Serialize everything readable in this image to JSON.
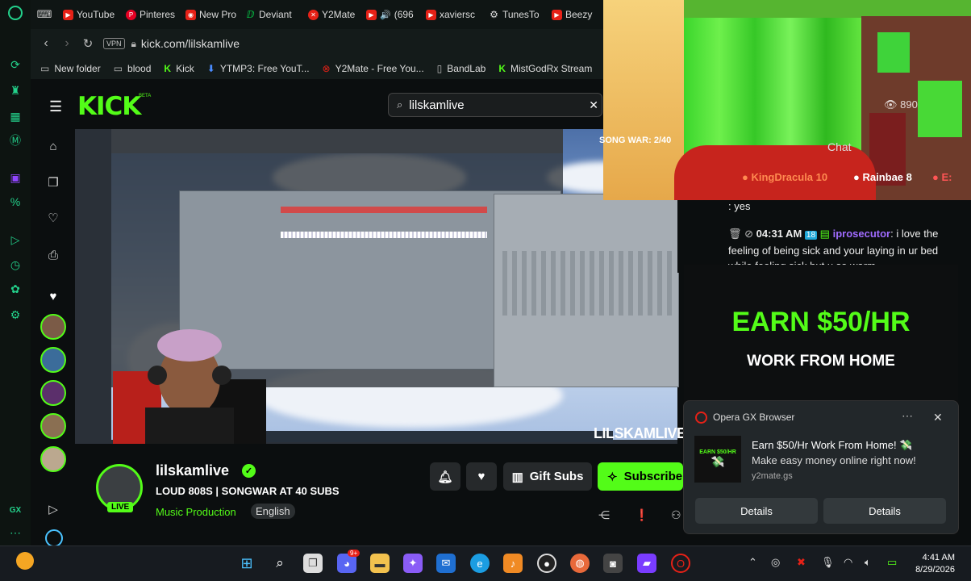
{
  "browser": {
    "tabs": [
      {
        "label": "YouTube",
        "color": "#e62117"
      },
      {
        "label": "Pinteres",
        "color": "#e60023"
      },
      {
        "label": "New Pro",
        "color": "#e62117"
      },
      {
        "label": "Deviant",
        "color": "#05cc47"
      },
      {
        "label": "Y2Mate",
        "color": "#e62117"
      },
      {
        "label": "(696",
        "color": "#e62117"
      },
      {
        "label": "xaviersc",
        "color": "#e62117"
      },
      {
        "label": "TunesTo",
        "color": "#555"
      },
      {
        "label": "Beezy",
        "color": "#e62117"
      }
    ],
    "vpn_label": "VPN",
    "url": "kick.com/lilskamlive",
    "bookmarks": [
      {
        "label": "New folder",
        "icon": "folder-icon"
      },
      {
        "label": "blood",
        "icon": "folder-icon"
      },
      {
        "label": "Kick",
        "icon": "kick-icon"
      },
      {
        "label": "YTMP3: Free YouT...",
        "icon": "download-icon"
      },
      {
        "label": "Y2Mate - Free You...",
        "icon": "y2mate-icon"
      },
      {
        "label": "BandLab",
        "icon": "page-icon"
      },
      {
        "label": "MistGodRx Stream",
        "icon": "kick-icon"
      }
    ]
  },
  "kick": {
    "logo": "KICK",
    "beta": "BETA",
    "search_value": "lilskamlive",
    "video_watermark": "LILSKAMLIVE",
    "song_war_overlay": "SONG WAR: 2/40",
    "channel": {
      "name": "lilskamlive",
      "title": "LOUD 808S | SONGWAR AT 40 SUBS",
      "category": "Music Production",
      "language": "English",
      "live_badge": "LIVE"
    },
    "buttons": {
      "gift_subs": "Gift Subs",
      "subscribe": "Subscribe"
    },
    "brand_color": "#53fc18"
  },
  "chat": {
    "label": "Chat",
    "viewer_count": "890",
    "top_gifters": [
      {
        "name": "KingDracula",
        "count": "10",
        "color": "#ff6b35"
      },
      {
        "name": "Rainbae",
        "count": "8",
        "color": "#ffffff"
      },
      {
        "name": "E:",
        "count": "",
        "color": "#ff4444"
      }
    ],
    "messages": [
      {
        "text": ": yes"
      },
      {
        "time": "04:31 AM",
        "user": "iprosecutor",
        "text": ": i love the feeling of being sick and your laying in ur bed while feeling sick but u so warm"
      }
    ]
  },
  "ad": {
    "headline": "EARN $50/HR",
    "subline": "WORK FROM HOME"
  },
  "notification": {
    "app": "Opera GX Browser",
    "thumb_text": "EARN $50/HR",
    "title": "Earn $50/Hr Work From Home! 💸",
    "body": "Make easy money online right now!",
    "source": "y2mate.gs",
    "button1": "Details",
    "button2": "Details"
  },
  "taskbar": {
    "time": "4:41 AM",
    "date": "8/29/2026",
    "discord_badge": "9+"
  }
}
